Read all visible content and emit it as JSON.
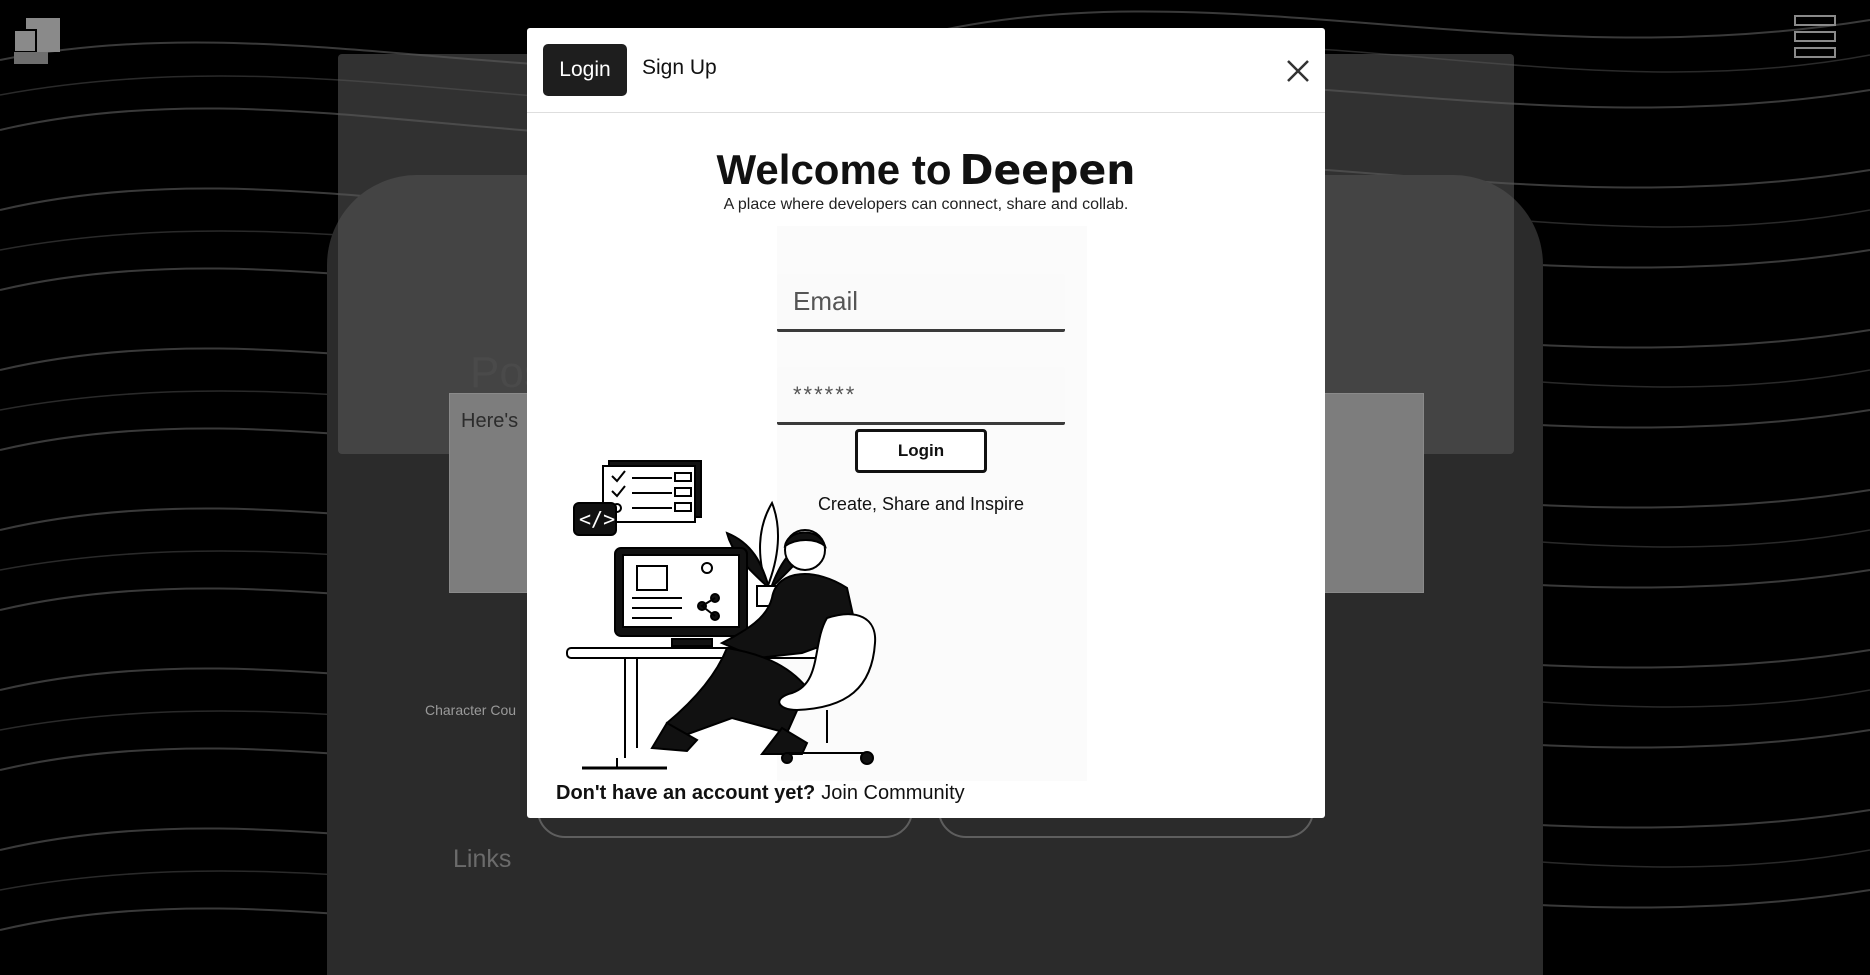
{
  "app": {
    "logo_icon": "logo-icon",
    "menu_icon": "hamburger-menu-icon"
  },
  "background_page": {
    "post_title_partial": "Pos",
    "textarea_placeholder_partial": "Here's",
    "character_count_partial": "Character Cou",
    "links_label": "Links"
  },
  "modal": {
    "tabs": [
      {
        "label": "Login",
        "active": true
      },
      {
        "label": "Sign Up",
        "active": false
      }
    ],
    "close_icon": "close-icon",
    "welcome_prefix": "Welcome to",
    "brand": "Deepen",
    "tagline": "A place where developers can connect, share and collab.",
    "email_placeholder": "Email",
    "password_placeholder": "******",
    "submit_label": "Login",
    "slogan": "Create, Share and Inspire",
    "signup_question": "Don't have an account yet?",
    "signup_link": "Join Community"
  },
  "colors": {
    "background": "#000000",
    "modal_bg": "#ffffff",
    "active_tab_bg": "#1e1e1e",
    "text": "#111111"
  }
}
